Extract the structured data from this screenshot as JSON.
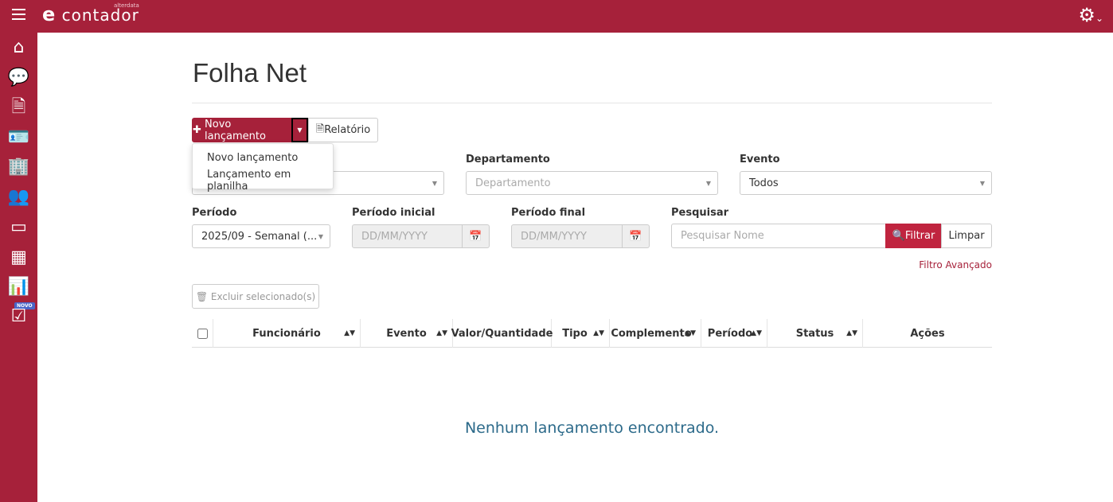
{
  "header": {
    "logo_text": "contador",
    "logo_brand": "alterdata",
    "logo_letter": "e"
  },
  "sidebar": {
    "items": [
      "home",
      "chat",
      "document",
      "contact-card",
      "building",
      "users",
      "credit-card",
      "calculator",
      "bar-chart",
      "checkbox"
    ],
    "badge": "NOVO"
  },
  "page": {
    "title": "Folha Net"
  },
  "toolbar": {
    "new_label": "Novo lançamento",
    "report_label": "Relatório",
    "delete_label": "Excluir selecionado(s)"
  },
  "dropdown": {
    "items": [
      "Novo lançamento",
      "Lançamento em planilha"
    ]
  },
  "filters": {
    "departamento": {
      "label": "Departamento",
      "placeholder": "Departamento"
    },
    "evento": {
      "label": "Evento",
      "value": "Todos"
    },
    "periodo": {
      "label": "Período",
      "value": "2025/09 - Semanal (..."
    },
    "periodo_inicial": {
      "label": "Período inicial",
      "placeholder": "DD/MM/YYYY"
    },
    "periodo_final": {
      "label": "Período final",
      "placeholder": "DD/MM/YYYY"
    },
    "pesquisar": {
      "label": "Pesquisar",
      "placeholder": "Pesquisar Nome"
    },
    "filter_button": "Filtrar",
    "clear_button": "Limpar",
    "advanced_link": "Filtro Avançado"
  },
  "table": {
    "columns": [
      "Funcionário",
      "Evento",
      "Valor/Quantidade",
      "Tipo",
      "Complemento",
      "Período",
      "Status",
      "Ações"
    ],
    "empty_message": "Nenhum lançamento encontrado."
  },
  "colors": {
    "brand": "#a6213a",
    "filter": "#c0243f",
    "empty": "#2c6a8a"
  }
}
